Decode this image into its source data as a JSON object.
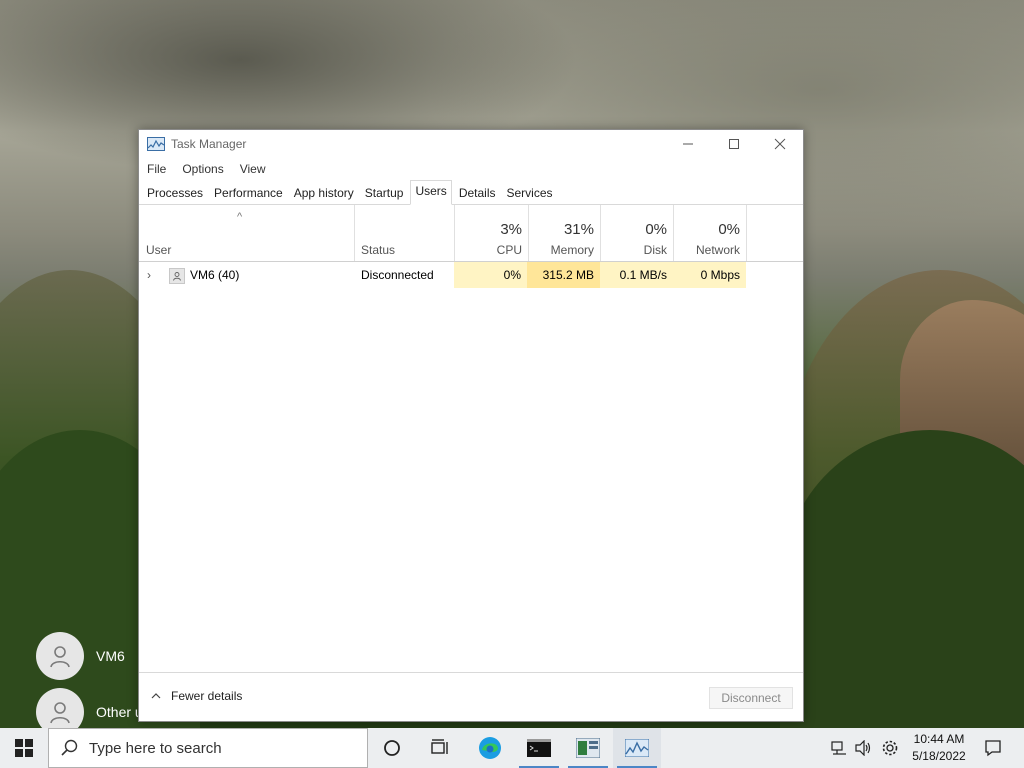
{
  "desktop": {
    "users": [
      {
        "name": "VM6"
      },
      {
        "name": "Other u"
      }
    ]
  },
  "window": {
    "title": "Task Manager",
    "menu": [
      "File",
      "Options",
      "View"
    ],
    "tabs": [
      "Processes",
      "Performance",
      "App history",
      "Startup",
      "Users",
      "Details",
      "Services"
    ],
    "active_tab": "Users",
    "columns": {
      "user": "User",
      "status": "Status",
      "cpu": {
        "pct": "3%",
        "label": "CPU"
      },
      "memory": {
        "pct": "31%",
        "label": "Memory"
      },
      "disk": {
        "pct": "0%",
        "label": "Disk"
      },
      "network": {
        "pct": "0%",
        "label": "Network"
      }
    },
    "rows": [
      {
        "user": "VM6 (40)",
        "status": "Disconnected",
        "cpu": "0%",
        "memory": "315.2 MB",
        "disk": "0.1 MB/s",
        "network": "0 Mbps"
      }
    ],
    "footer": {
      "fewer_details": "Fewer details",
      "disconnect": "Disconnect"
    }
  },
  "taskbar": {
    "search_placeholder": "Type here to search",
    "time": "10:44 AM",
    "date": "5/18/2022"
  },
  "colors": {
    "cpu_heat": "#fff4c4",
    "memory_heat": "#ffe699",
    "taskbar_bg": "#eceef0",
    "running_indicator": "#4c86c6"
  }
}
